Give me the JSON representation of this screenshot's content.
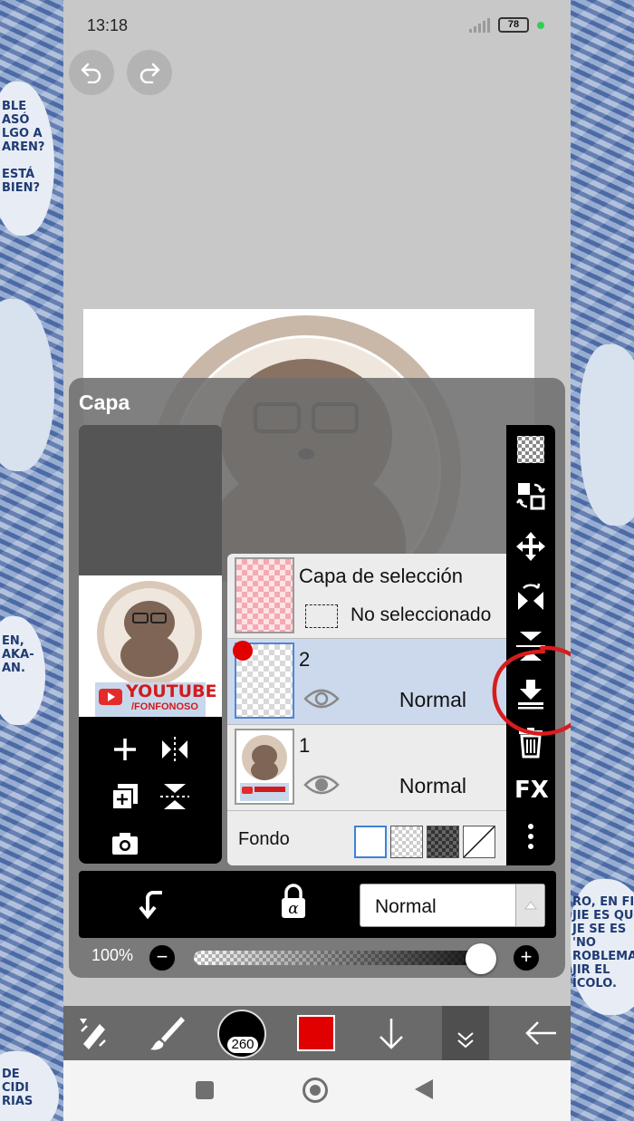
{
  "status_bar": {
    "time": "13:18",
    "battery": "78"
  },
  "panel": {
    "title": "Capa"
  },
  "thumbnail": {
    "banner_title": "YOUTUBE",
    "banner_handle": "/FONFONOSO"
  },
  "layers": [
    {
      "name": "Capa de selección",
      "status": "No seleccionado"
    },
    {
      "name": "2",
      "mode": "Normal"
    },
    {
      "name": "1",
      "mode": "Normal"
    }
  ],
  "background_label": "Fondo",
  "blend_mode": "Normal",
  "opacity": {
    "label": "100%",
    "value": 1.0
  },
  "brush_size": "260",
  "colors": {
    "primary": "#e00000",
    "selected_layer": "#ccd9ec",
    "annotation": "#d81c1c"
  },
  "icons": {
    "undo": "undo-icon",
    "redo": "redo-icon",
    "add_layer": "plus-icon",
    "flip": "flip-icon",
    "copy_layer": "copy-icon",
    "flip_v": "flip-vertical-icon",
    "camera": "camera-icon",
    "clipping": "clipping-icon",
    "alpha_lock": "alpha-lock-icon",
    "transparency": "checker-icon",
    "selection_transform": "transform-icon",
    "move": "move-icon",
    "flip_h": "flip-horizontal-icon",
    "merge_down": "merge-down-icon",
    "delete": "trash-icon",
    "fx": "FX",
    "more": "more-icon"
  }
}
